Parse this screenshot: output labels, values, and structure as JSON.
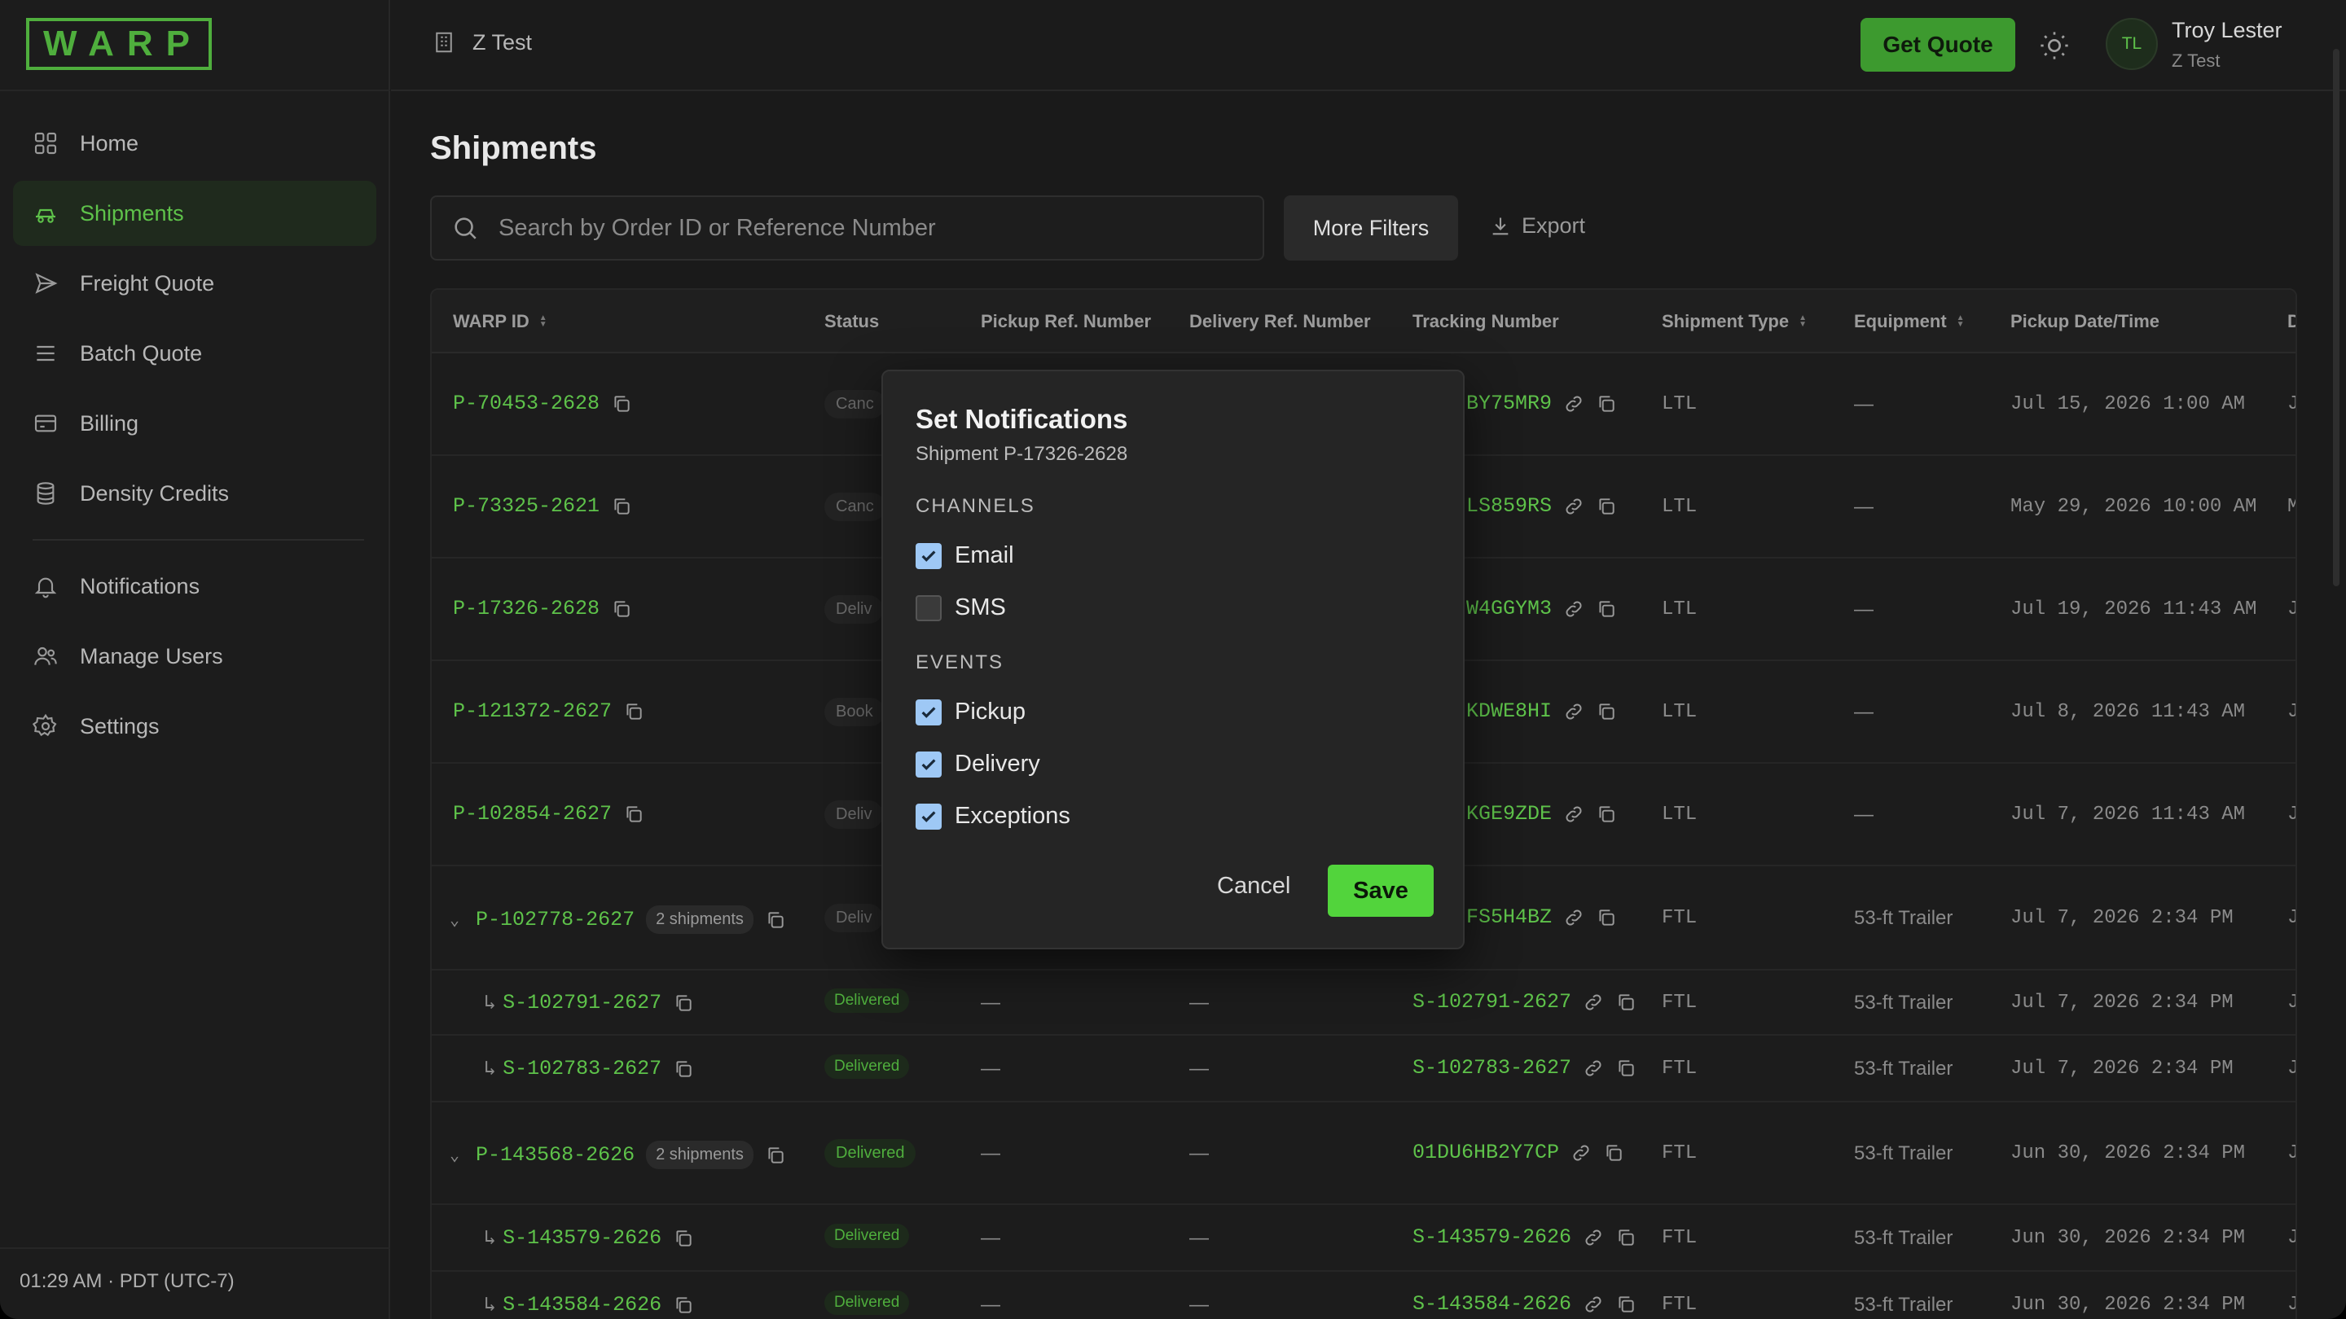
{
  "brand": {
    "logo": "WARP"
  },
  "sidebar": {
    "items": [
      {
        "label": "Home",
        "icon": "home-grid-icon"
      },
      {
        "label": "Shipments",
        "icon": "truck-icon"
      },
      {
        "label": "Freight Quote",
        "icon": "send-icon"
      },
      {
        "label": "Batch Quote",
        "icon": "list-icon"
      },
      {
        "label": "Billing",
        "icon": "card-icon"
      },
      {
        "label": "Density Credits",
        "icon": "database-icon"
      },
      {
        "label": "Notifications",
        "icon": "bell-icon"
      },
      {
        "label": "Manage Users",
        "icon": "users-icon"
      },
      {
        "label": "Settings",
        "icon": "gear-icon"
      }
    ],
    "timezone": "01:29 AM · PDT (UTC-7)"
  },
  "topbar": {
    "company": "Z Test",
    "get_quote": "Get Quote",
    "user": {
      "initials": "TL",
      "name": "Troy Lester",
      "org": "Z Test"
    }
  },
  "page": {
    "title": "Shipments",
    "search_placeholder": "Search by Order ID or Reference Number",
    "more_filters": "More Filters",
    "export": "Export"
  },
  "table": {
    "columns": [
      "WARP ID",
      "Status",
      "Pickup Ref. Number",
      "Delivery Ref. Number",
      "Tracking Number",
      "Shipment Type",
      "Equipment",
      "Pickup Date/Time",
      "D"
    ],
    "rows": [
      {
        "id": "P-70453-2628",
        "status": "Canc",
        "pickup_ref": "",
        "delivery_ref": "",
        "tracking": "BY75MR9",
        "type": "LTL",
        "equipment": "—",
        "pickup": "Jul 15, 2026 1:00 AM",
        "d": "J"
      },
      {
        "id": "P-73325-2621",
        "status": "Canc",
        "pickup_ref": "",
        "delivery_ref": "",
        "tracking": "LS859RS",
        "type": "LTL",
        "equipment": "—",
        "pickup": "May 29, 2026 10:00 AM",
        "d": "M"
      },
      {
        "id": "P-17326-2628",
        "status": "Deliv",
        "pickup_ref": "",
        "delivery_ref": "",
        "tracking": "W4GGYM3",
        "type": "LTL",
        "equipment": "—",
        "pickup": "Jul 19, 2026 11:43 AM",
        "d": "J"
      },
      {
        "id": "P-121372-2627",
        "status": "Book",
        "pickup_ref": "",
        "delivery_ref": "",
        "tracking": "KDWE8HI",
        "type": "LTL",
        "equipment": "—",
        "pickup": "Jul 8, 2026 11:43 AM",
        "d": "J"
      },
      {
        "id": "P-102854-2627",
        "status": "Deliv",
        "pickup_ref": "",
        "delivery_ref": "",
        "tracking": "KGE9ZDE",
        "type": "LTL",
        "equipment": "—",
        "pickup": "Jul 7, 2026 11:43 AM",
        "d": "J"
      },
      {
        "id": "P-102778-2627",
        "count": "2 shipments",
        "status": "Deliv",
        "pickup_ref": "",
        "delivery_ref": "",
        "tracking": "FS5H4BZ",
        "type": "FTL",
        "equipment": "53-ft Trailer",
        "pickup": "Jul 7, 2026 2:34 PM",
        "d": "J"
      },
      {
        "id": "S-102791-2627",
        "status": "Delivered",
        "pickup_ref": "—",
        "delivery_ref": "—",
        "tracking": "S-102791-2627",
        "type": "FTL",
        "equipment": "53-ft Trailer",
        "pickup": "Jul 7, 2026 2:34 PM",
        "d": "J"
      },
      {
        "id": "S-102783-2627",
        "status": "Delivered",
        "pickup_ref": "—",
        "delivery_ref": "—",
        "tracking": "S-102783-2627",
        "type": "FTL",
        "equipment": "53-ft Trailer",
        "pickup": "Jul 7, 2026 2:34 PM",
        "d": "J"
      },
      {
        "id": "P-143568-2626",
        "count": "2 shipments",
        "status": "Delivered",
        "pickup_ref": "—",
        "delivery_ref": "—",
        "tracking": "01DU6HB2Y7CP",
        "type": "FTL",
        "equipment": "53-ft Trailer",
        "pickup": "Jun 30, 2026 2:34 PM",
        "d": "J"
      },
      {
        "id": "S-143579-2626",
        "status": "Delivered",
        "pickup_ref": "—",
        "delivery_ref": "—",
        "tracking": "S-143579-2626",
        "type": "FTL",
        "equipment": "53-ft Trailer",
        "pickup": "Jun 30, 2026 2:34 PM",
        "d": "J"
      },
      {
        "id": "S-143584-2626",
        "status": "Delivered",
        "pickup_ref": "—",
        "delivery_ref": "—",
        "tracking": "S-143584-2626",
        "type": "FTL",
        "equipment": "53-ft Trailer",
        "pickup": "Jun 30, 2026 2:34 PM",
        "d": "J"
      }
    ]
  },
  "modal": {
    "title": "Set Notifications",
    "subtitle": "Shipment P-17326-2628",
    "channels_label": "CHANNELS",
    "channels": [
      {
        "label": "Email",
        "checked": true
      },
      {
        "label": "SMS",
        "checked": false
      }
    ],
    "events_label": "EVENTS",
    "events": [
      {
        "label": "Pickup",
        "checked": true
      },
      {
        "label": "Delivery",
        "checked": true
      },
      {
        "label": "Exceptions",
        "checked": true
      }
    ],
    "cancel": "Cancel",
    "save": "Save"
  },
  "colors": {
    "accent": "#5ec24a",
    "save": "#52d43c",
    "checkbox": "#9ec8f5"
  }
}
